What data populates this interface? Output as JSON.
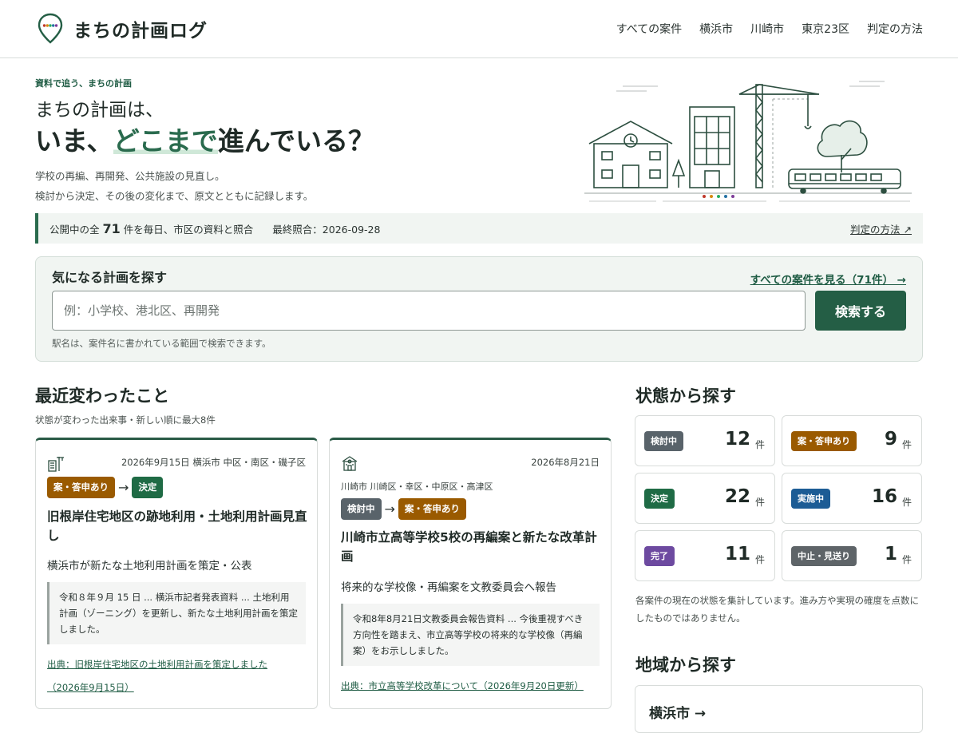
{
  "header": {
    "site_title": "まちの計画ログ",
    "nav": [
      "すべての案件",
      "横浜市",
      "川崎市",
      "東京23区",
      "判定の方法"
    ]
  },
  "hero": {
    "kicker": "資料で追う、まちの計画",
    "line1": "まちの計画は、",
    "line2_pre": "いま、",
    "line2_highlight": "どこまで",
    "line2_post": "進んでいる？",
    "desc_line1": "学校の再編、再開発、公共施設の見直し。",
    "desc_line2": "検討から決定、その後の変化まで、原文とともに記録します。"
  },
  "status_bar": {
    "prefix": "公開中の全",
    "count": "71",
    "suffix": "件を毎日、市区の資料と照合",
    "last_checked": "最終照合：2026-09-28",
    "method_link": "判定の方法 ↗"
  },
  "search": {
    "title": "気になる計画を探す",
    "all_link": "すべての案件を見る（71件） →",
    "placeholder": "例：小学校、港北区、再開発",
    "button": "検索する",
    "hint": "駅名は、案件名に書かれている範囲で検索できます。"
  },
  "recent": {
    "title": "最近変わったこと",
    "subtitle": "状態が変わった出来事・新しい順に最大8件",
    "cards": [
      {
        "icon": "building-crane-icon",
        "meta": "2026年9月15日  横浜市 中区・南区・磯子区",
        "from_badge": "案・答申あり",
        "to_badge": "決定",
        "title": "旧根岸住宅地区の跡地利用・土地利用計画見直し",
        "summary": "横浜市が新たな土地利用計画を策定・公表",
        "quote": "令和８年９月 15 日 ... 横浜市記者発表資料 ... 土地利用計画（ゾーニング）を更新し、新たな土地利用計画を策定しました。",
        "source_line1": "出典：旧根岸住宅地区の土地利用計画を策定しました",
        "source_line2": "（2026年9月15日）"
      },
      {
        "icon": "school-icon",
        "meta": "2026年8月21日",
        "meta2": "川崎市 川崎区・幸区・中原区・高津区",
        "from_badge": "検討中",
        "to_badge": "案・答申あり",
        "title": "川崎市立高等学校5校の再編案と新たな改革計画",
        "summary": "将来的な学校像・再編案を文教委員会へ報告",
        "quote": "令和8年8月21日文教委員会報告資料 ... 今後重視すべき方向性を踏まえ、市立高等学校の将来的な学校像（再編案）をお示ししました。",
        "source_line1": "出典：市立高等学校改革について（2026年9月20日更新）"
      }
    ]
  },
  "status_section": {
    "title": "状態から探す",
    "unit": "件",
    "tiles": [
      {
        "label": "検討中",
        "count": "12",
        "color": "#59636a"
      },
      {
        "label": "案・答申あり",
        "count": "9",
        "color": "#9a5a00"
      },
      {
        "label": "決定",
        "count": "22",
        "color": "#1f6b45"
      },
      {
        "label": "実施中",
        "count": "16",
        "color": "#1c5c95"
      },
      {
        "label": "完了",
        "count": "11",
        "color": "#6d4aa0"
      },
      {
        "label": "中止・見送り",
        "count": "1",
        "color": "#5e6468"
      }
    ],
    "note": "各案件の現在の状態を集計しています。進み方や実現の確度を点数にしたものではありません。"
  },
  "region_section": {
    "title": "地域から探す",
    "first_region": "横浜市 →"
  },
  "colors": {
    "brand": "#245e45",
    "accent_highlight": "#2a6b4e"
  }
}
